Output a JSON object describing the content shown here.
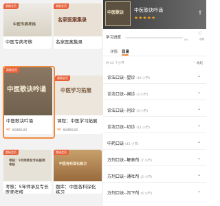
{
  "left": {
    "cards": [
      {
        "badge": "超级会员",
        "cover_text": "中医专病考核",
        "title": "中医专病考核",
        "free": "",
        "orig": ""
      },
      {
        "badge": "超级会员",
        "cover_text": "名家医案集录",
        "title": "名家医案集录",
        "free": "",
        "orig": ""
      },
      {
        "badge": "超级会员",
        "cover_text": "中医歌诀吟诵",
        "title": "中医歌诀吟诵",
        "free": "¥0",
        "orig": "¥1980.00"
      },
      {
        "badge": "超级会员",
        "cover_text": "中医学习拓展",
        "title": "课程：中医学习拓展",
        "free": "¥0",
        "orig": "¥1980.00"
      },
      {
        "badge": "超级会员",
        "cover_text": "考核：5年师承及专长医师考核",
        "title": "考核：5年师承及专长医师考核",
        "free": "",
        "orig": ""
      },
      {
        "badge": "超级会员",
        "cover_text": "中医各科深化练习",
        "title": "题库：中医各科深化练习",
        "free": "",
        "orig": ""
      }
    ]
  },
  "course": {
    "title": "中医歌诀吟诵",
    "stars": "★★★★★",
    "thumb_text": "中医歌诀",
    "progress_label": "学习进度",
    "progress_value": 0.0,
    "progress_pct": "0%",
    "favorite_label": "收藏"
  },
  "tabs": [
    {
      "label": "详情"
    },
    {
      "label": "目录"
    }
  ],
  "toc": {
    "total": "共 43 个小节",
    "collapse": "收起"
  },
  "chapters": [
    {
      "name": "诊法口诀--望诊",
      "count": "(16 小节)"
    },
    {
      "name": "诊法口诀--闻诊",
      "count": "(3 小节)"
    },
    {
      "name": "诊法口诀--问诊",
      "count": "(3 小节)"
    },
    {
      "name": "诊法口诀--切诊",
      "count": "(11 小节)"
    },
    {
      "name": "中药口诀",
      "count": "(45 小节)"
    },
    {
      "name": "方剂口诀--解表剂",
      "count": "(7 小节)"
    },
    {
      "name": "方剂口诀--涌吐剂",
      "count": "(2 小节)"
    },
    {
      "name": "方剂口诀--泻下剂",
      "count": "(6 小节)"
    }
  ],
  "colors": {
    "accent": "#f08a3c",
    "badge": "#e8603a"
  }
}
